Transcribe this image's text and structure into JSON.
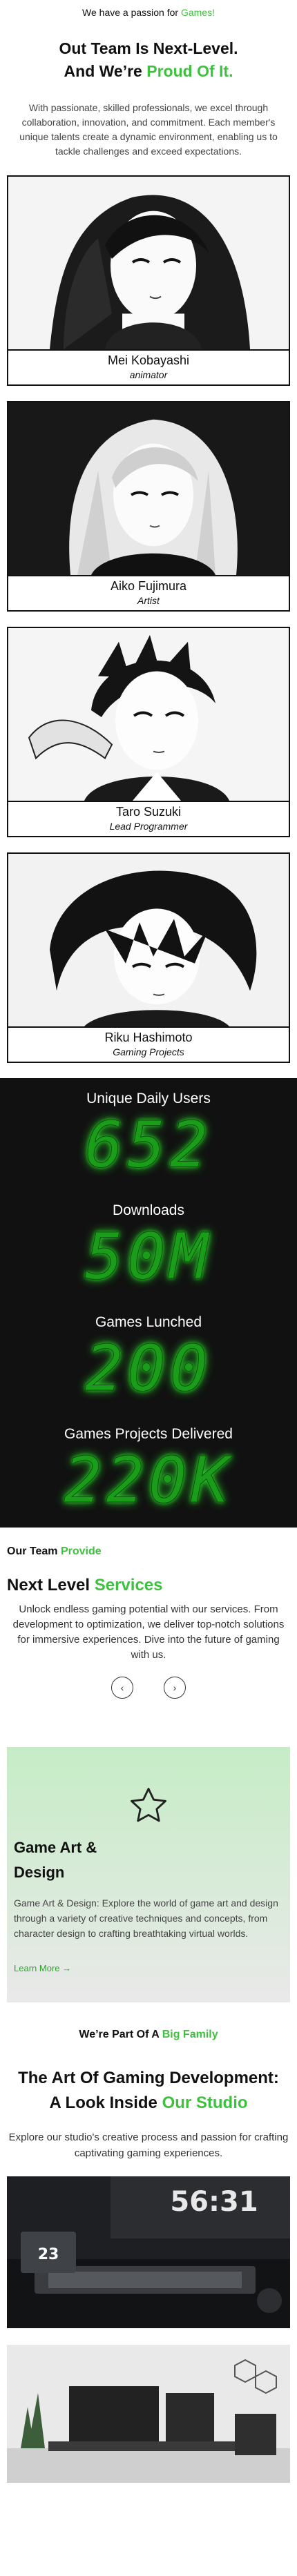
{
  "hero": {
    "eyebrow_prefix": "We have a passion for ",
    "eyebrow_accent": "Games!",
    "title_line1": "Out Team Is Next-Level.",
    "title_line2_prefix": "And We’re ",
    "title_line2_accent": "Proud Of It.",
    "paragraph": "With passionate, skilled professionals, we excel through collaboration, innovation, and commitment. Each member's unique talents create a dynamic environment, enabling us to tackle challenges and exceed expectations."
  },
  "team": [
    {
      "name": "Mei Kobayashi",
      "role": "animator"
    },
    {
      "name": "Aiko Fujimura",
      "role": "Artist"
    },
    {
      "name": "Taro Suzuki",
      "role": "Lead Programmer"
    },
    {
      "name": "Riku Hashimoto",
      "role": "Gaming Projects"
    }
  ],
  "stats": [
    {
      "label": "Unique Daily Users",
      "value": "652"
    },
    {
      "label": "Downloads",
      "value": "50M"
    },
    {
      "label": "Games Lunched",
      "value": "200"
    },
    {
      "label": "Games Projects Delivered",
      "value": "220K"
    }
  ],
  "services": {
    "kicker_prefix": "Our Team ",
    "kicker_accent": "Provide",
    "title_prefix": "Next Level ",
    "title_accent": "Services",
    "paragraph": "Unlock endless gaming potential with our services. From development to optimization, we deliver top-notch solutions for immersive experiences. Dive into the future of gaming with us.",
    "prev_icon": "‹",
    "next_icon": "›",
    "card": {
      "icon": "star-icon",
      "title": "Game Art & Design",
      "text": "Game Art & Design: Explore the world of game art and design through a variety of creative techniques and concepts, from character design to crafting breathtaking virtual worlds.",
      "link": "Learn More",
      "link_arrow": "→"
    }
  },
  "studio": {
    "family_prefix": "We’re Part Of A ",
    "family_accent": "Big Family",
    "title_line1": "The Art Of Gaming Development:",
    "title_line2_prefix": "A Look Inside ",
    "title_line2_accent": "Our Studio",
    "paragraph": "Explore our studio's creative process and passion for crafting captivating gaming experiences.",
    "photo1_clock": "56:31",
    "photo1_badge": "23"
  },
  "colors": {
    "accent": "#3ec13e",
    "dark": "#111111",
    "digit_green": "#1a9e1a"
  }
}
